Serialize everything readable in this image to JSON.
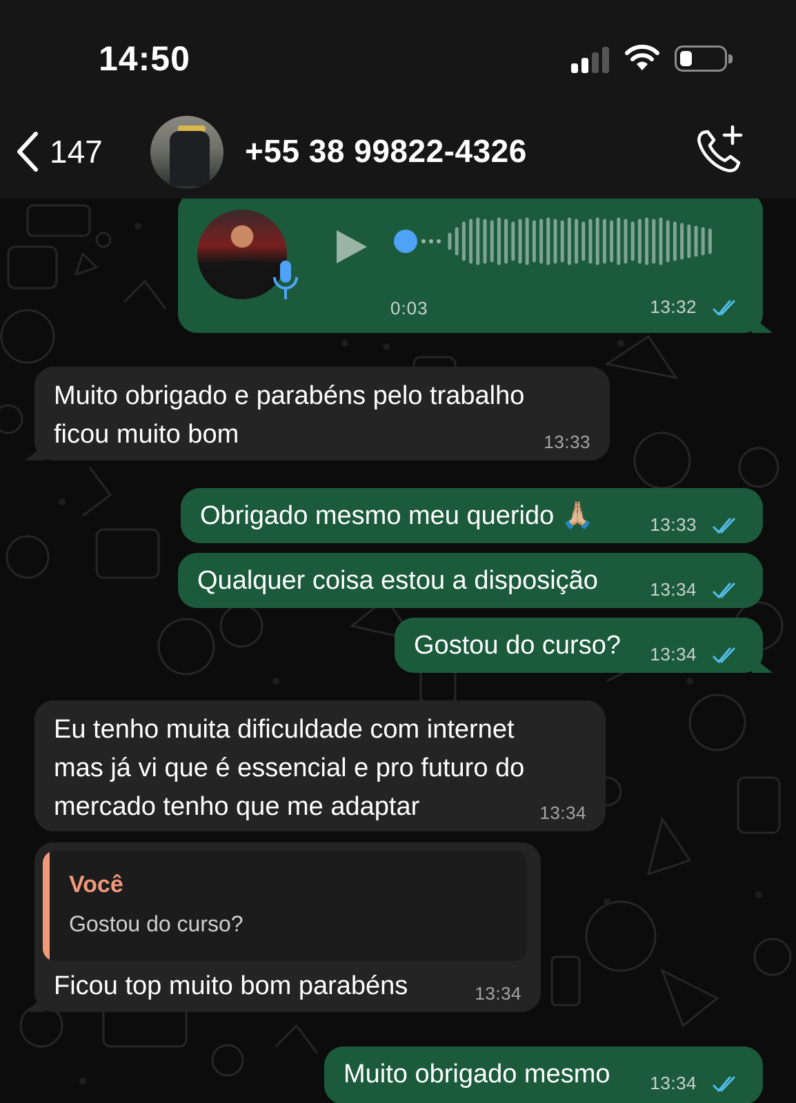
{
  "status_bar": {
    "time": "14:50",
    "battery_level": 0.2,
    "signal_bars": 2
  },
  "header": {
    "back_count": "147",
    "contact_name": "+55 38 99822-4326"
  },
  "messages": [
    {
      "type": "voice",
      "direction": "out",
      "duration": "0:03",
      "time": "13:32",
      "status": "read"
    },
    {
      "type": "text",
      "direction": "in",
      "lines": [
        "Muito obrigado e parabéns pelo trabalho",
        "ficou muito bom"
      ],
      "time": "13:33"
    },
    {
      "type": "text",
      "direction": "out",
      "text": "Obrigado mesmo meu querido 🙏🏼",
      "time": "13:33",
      "status": "read"
    },
    {
      "type": "text",
      "direction": "out",
      "text": "Qualquer coisa estou a disposição",
      "time": "13:34",
      "status": "read"
    },
    {
      "type": "text",
      "direction": "out",
      "text": "Gostou do curso?",
      "time": "13:34",
      "status": "read"
    },
    {
      "type": "text",
      "direction": "in",
      "lines": [
        "Eu tenho muita dificuldade com internet",
        "mas já vi que é essencial e pro futuro do",
        "mercado tenho que me adaptar"
      ],
      "time": "13:34"
    },
    {
      "type": "reply",
      "direction": "in",
      "quote_author": "Você",
      "quote_text": "Gostou do curso?",
      "text": "Ficou top muito bom parabéns",
      "time": "13:34"
    },
    {
      "type": "text",
      "direction": "out",
      "text": "Muito obrigado mesmo",
      "time": "13:34",
      "status": "read"
    }
  ],
  "colors": {
    "outgoing_bubble": "#1b5b3c",
    "incoming_bubble": "#242424",
    "read_ticks": "#53bdeb",
    "quote_accent": "#f0997b",
    "voice_dot": "#4fa3f7"
  },
  "icons": [
    "back-chevron-icon",
    "call-add-icon",
    "play-icon",
    "microphone-icon",
    "double-check-icon",
    "wifi-icon",
    "signal-icon",
    "battery-icon"
  ]
}
